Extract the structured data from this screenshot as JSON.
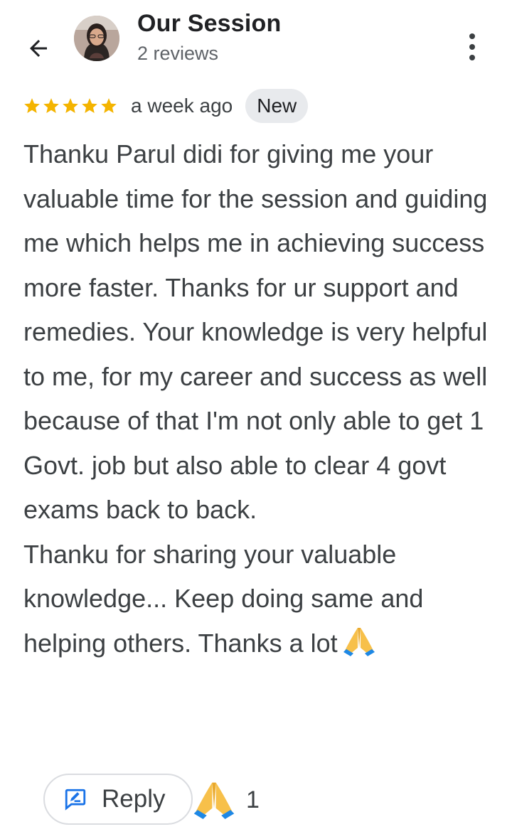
{
  "header": {
    "title": "Our Session",
    "subtitle": "2 reviews"
  },
  "review": {
    "rating": 5,
    "max_rating": 5,
    "time_ago": "a week ago",
    "badge": "New",
    "text": "Thanku Parul didi for giving me your valuable time for the session and guiding me which helps me in achieving success more faster. Thanks for ur support and remedies. Your knowledge is very helpful to me, for my career and success as well because of that I'm not only able to get 1 Govt. job but also able to clear 4 govt exams back to back.\nThanku for sharing your valuable knowledge... Keep doing same and helping others. Thanks a lot",
    "text_emoji": "folded-hands"
  },
  "actions": {
    "reply_label": "Reply",
    "reaction_emoji": "folded-hands",
    "reaction_count": "1"
  },
  "colors": {
    "star": "#f4b400",
    "reply_icon": "#1a73e8",
    "badge_bg": "#e8eaed",
    "text": "#3c4043"
  },
  "icons": {
    "back": "arrow-back-icon",
    "more": "more-vertical-icon",
    "reply": "reply-edit-icon"
  }
}
